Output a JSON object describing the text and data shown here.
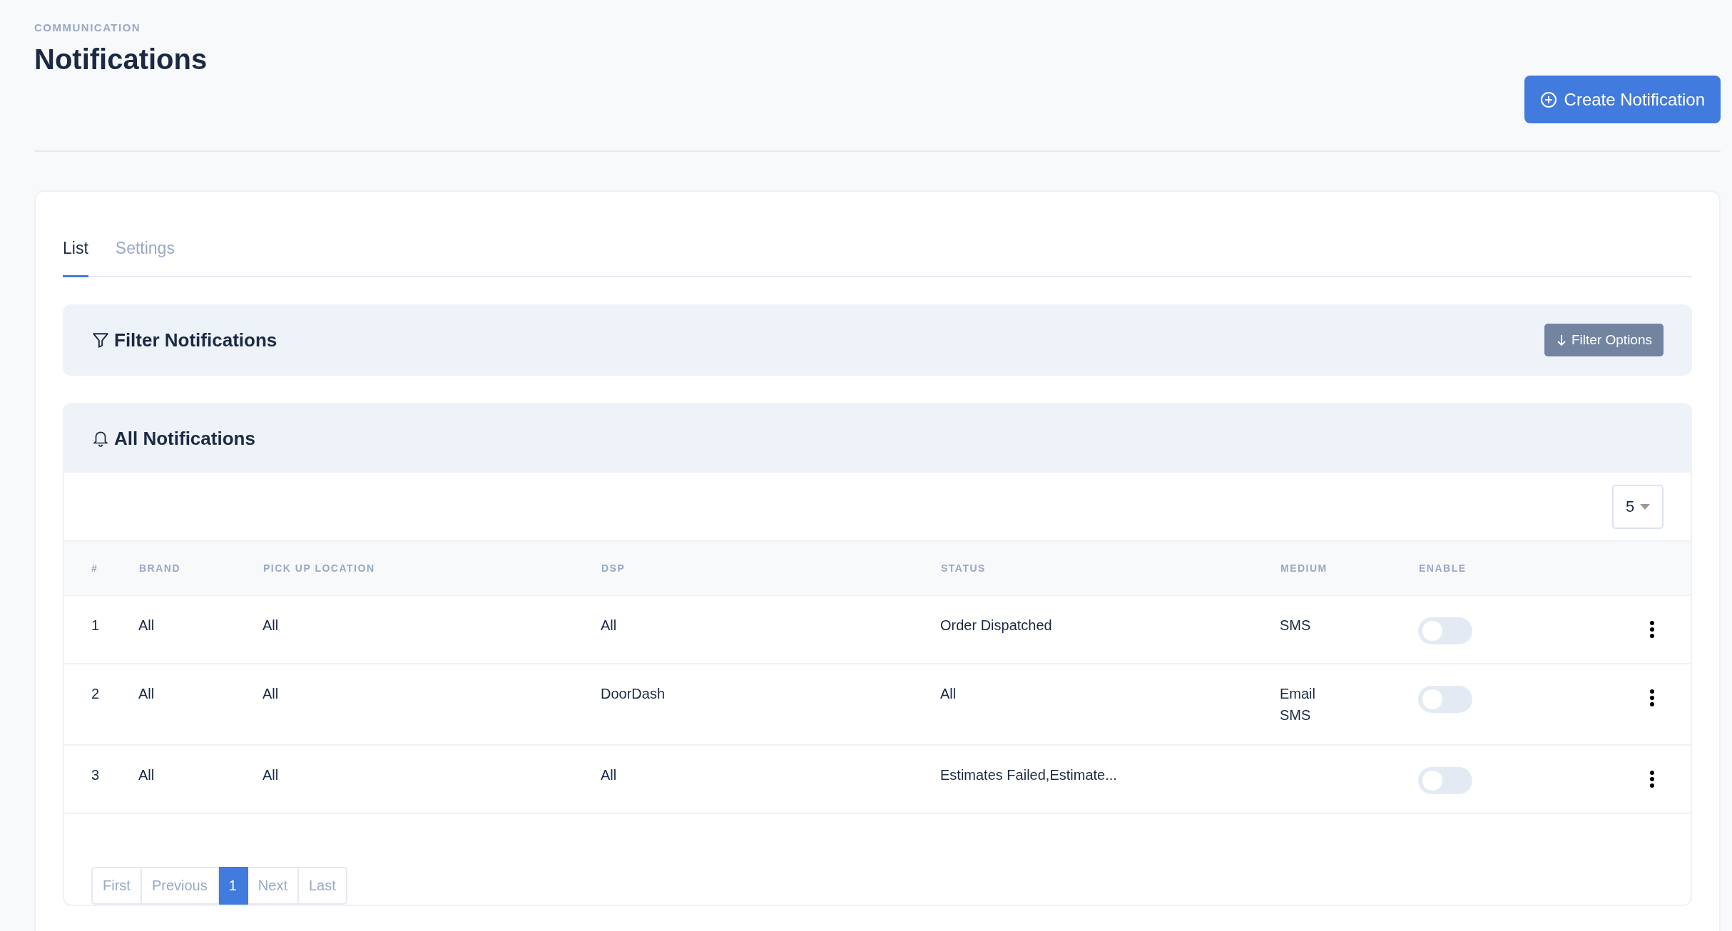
{
  "header": {
    "eyebrow": "COMMUNICATION",
    "title": "Notifications",
    "create_button": "Create Notification"
  },
  "tabs": [
    {
      "label": "List",
      "selected": true
    },
    {
      "label": "Settings",
      "selected": false
    }
  ],
  "filter_panel": {
    "title": "Filter Notifications",
    "button": "Filter Options"
  },
  "notifications_panel": {
    "title": "All Notifications",
    "page_size": "5"
  },
  "table": {
    "columns": [
      "#",
      "BRAND",
      "PICK UP LOCATION",
      "DSP",
      "STATUS",
      "MEDIUM",
      "ENABLE"
    ],
    "rows": [
      {
        "number": "1",
        "brand": "All",
        "pickup_location": "All",
        "dsp": "All",
        "status": "Order Dispatched",
        "medium": [
          "SMS"
        ],
        "enabled": false
      },
      {
        "number": "2",
        "brand": "All",
        "pickup_location": "All",
        "dsp": "DoorDash",
        "status": "All",
        "medium": [
          "Email",
          "SMS"
        ],
        "enabled": false
      },
      {
        "number": "3",
        "brand": "All",
        "pickup_location": "All",
        "dsp": "All",
        "status": "Estimates Failed,Estimate...",
        "medium": [],
        "enabled": false
      }
    ]
  },
  "pagination": [
    {
      "label": "First",
      "selected": false
    },
    {
      "label": "Previous",
      "selected": false
    },
    {
      "label": "1",
      "selected": true
    },
    {
      "label": "Next",
      "selected": false
    },
    {
      "label": "Last",
      "selected": false
    }
  ]
}
